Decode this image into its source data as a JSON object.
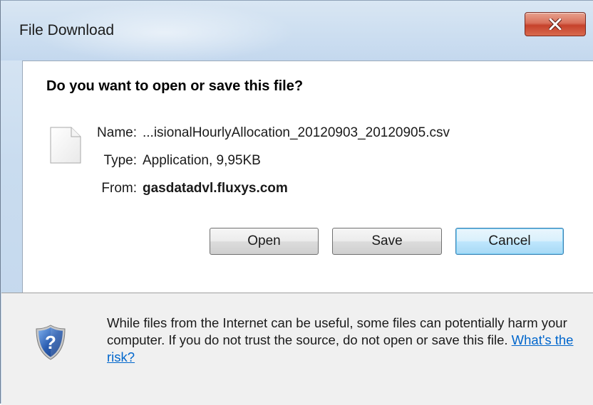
{
  "window": {
    "title": "File Download"
  },
  "dialog": {
    "question": "Do you want to open or save this file?",
    "file": {
      "name_label": "Name:",
      "name_value": "...isionalHourlyAllocation_20120903_20120905.csv",
      "type_label": "Type:",
      "type_value": "Application, 9,95KB",
      "from_label": "From:",
      "from_value": "gasdatadvl.fluxys.com"
    },
    "buttons": {
      "open": "Open",
      "save": "Save",
      "cancel": "Cancel"
    },
    "warning": {
      "text": "While files from the Internet can be useful, some files can potentially harm your computer. If you do not trust the source, do not open or save this file.",
      "link": "What's the risk?"
    }
  },
  "icons": {
    "file": "file-icon",
    "shield": "shield-question-icon",
    "close": "close-icon"
  },
  "colors": {
    "close_button": "#c6422c",
    "link": "#0066cc",
    "default_button_border": "#3c7fb1",
    "shield_blue": "#2a5db0"
  }
}
